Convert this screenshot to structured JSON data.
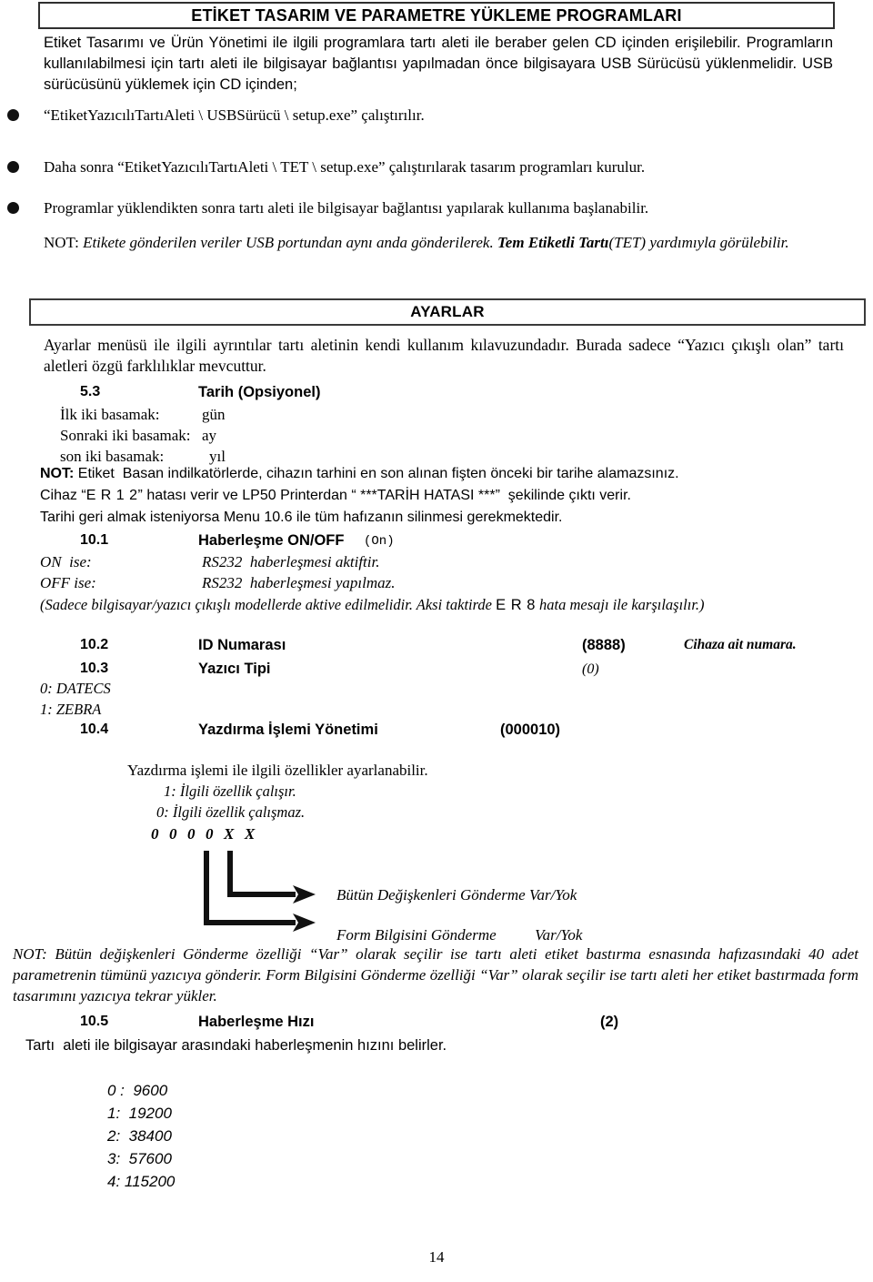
{
  "document": {
    "page_number": "14"
  },
  "title_box": {
    "text": "ETİKET TASARIM VE PARAMETRE YÜKLEME PROGRAMLARI"
  },
  "intro": {
    "paragraph": "Etiket Tasarımı ve Ürün Yönetimi ile ilgili programlara tartı aleti ile beraber gelen CD içinden erişilebilir. Programların kullanılabilmesi için tartı aleti ile bilgisayar bağlantısı yapılmadan önce bilgisayara USB Sürücüsü yüklenmelidir. USB sürücüsünü yüklemek için CD içinden;"
  },
  "bullets": [
    {
      "text": "“EtiketYazıcılıTartıAleti \\ USBSürücü \\ setup.exe” çalıştırılır."
    },
    {
      "text": "Daha sonra  “EtiketYazıcılıTartıAleti \\ TET \\ setup.exe” çalıştırılarak tasarım programları kurulur."
    },
    {
      "text": "Programlar yüklendikten sonra tartı aleti ile bilgisayar bağlantısı yapılarak kullanıma başlanabilir."
    }
  ],
  "note_usb": {
    "label": "NOT:",
    "body_1": "Etikete gönderilen veriler USB portundan aynı anda gönderilerek.",
    "bold_part": "Tem Etiketli Tartı",
    "body_2": "(TET) yardımıyla görülebilir."
  },
  "ayarlar_box": {
    "text": "AYARLAR"
  },
  "ayarlar_intro": {
    "paragraph": "Ayarlar menüsü ile ilgili ayrıntılar tartı aletinin kendi kullanım kılavuzundadır. Burada sadece “Yazıcı çıkışlı olan” tartı aletleri özgü farklılıklar mevcuttur."
  },
  "menu_5_3": {
    "number": "5.3",
    "label": "Tarih  (Opsiyonel)",
    "rows": [
      {
        "key": "İlk iki basamak:",
        "value": "gün"
      },
      {
        "key": "Sonraki iki basamak:",
        "value": "ay"
      },
      {
        "key": "son iki basamak:",
        "value": "yıl"
      }
    ]
  },
  "note_date": {
    "label": "NOT:",
    "line_1": "Etiket  Basan indilkatörlerde, cihazın tarhini en son alınan fişten önceki bir tarihe alamazsınız.",
    "line_2_a": "Cihaz “",
    "line_2_code": "E R 1 2",
    "line_2_b": "” hatası verir ve LP50 Printerdan “ ***TARİH HATASI ***”  şekilinde çıktı verir.",
    "line_3": "Tarihi geri almak isteniyorsa Menu 10.6 ile tüm hafızanın silinmesi gerekmektedir."
  },
  "menu_10_1": {
    "number": "10.1",
    "label": "Haberleşme ON/OFF",
    "value": "(On)",
    "on_key": "ON  ise:",
    "on_value": "RS232  haberleşmesi aktiftir.",
    "off_key": "OFF ise:",
    "off_value": "RS232  haberleşmesi yapılmaz.",
    "footnote_a": "(Sadece bilgisayar/yazıcı çıkışlı modellerde aktive edilmelidir. Aksi taktirde ",
    "footnote_code": "E R   8",
    "footnote_b": " hata mesajı ile karşılaşılır.)"
  },
  "menu_10_2": {
    "number": "10.2",
    "label": "ID Numarası",
    "value": "(8888)",
    "comment": "Cihaza ait numara."
  },
  "menu_10_3": {
    "number": "10.3",
    "label": "Yazıcı Tipi",
    "value": "(0)",
    "options": [
      "0: DATECS",
      "1: ZEBRA"
    ]
  },
  "menu_10_4": {
    "number": "10.4",
    "label": "Yazdırma İşlemi Yönetimi",
    "value": "(000010)",
    "description": "Yazdırma işlemi ile ilgili özellikler ayarlanabilir.",
    "legend": [
      "1: İlgili özellik çalışır.",
      "0: İlgili özellik çalışmaz."
    ],
    "bitmask": "0  0  0  0  X  X",
    "arrow_labels": [
      "Bütün Değişkenleri Gönderme Var/Yok",
      "Form Bilgisini Gönderme          Var/Yok"
    ]
  },
  "note_vars": {
    "label": "NOT:",
    "text": "Bütün değişkenleri Gönderme özelliği “Var” olarak seçilir ise tartı aleti etiket bastırma esnasında hafızasındaki 40 adet parametrenin tümünü yazıcıya      gönderir. Form Bilgisini Gönderme özelliği “Var” olarak seçilir ise tartı aleti her etiket bastırmada form tasarımını yazıcıya tekrar yükler."
  },
  "menu_10_5": {
    "number": "10.5",
    "label": "Haberleşme Hızı",
    "value": "(2)",
    "description": "Tartı  aleti ile bilgisayar arasındaki haberleşmenin hızını belirler.",
    "baud_rates": [
      "0 :  9600",
      "1:  19200",
      "2:  38400",
      "3:  57600",
      "4: 115200"
    ]
  }
}
